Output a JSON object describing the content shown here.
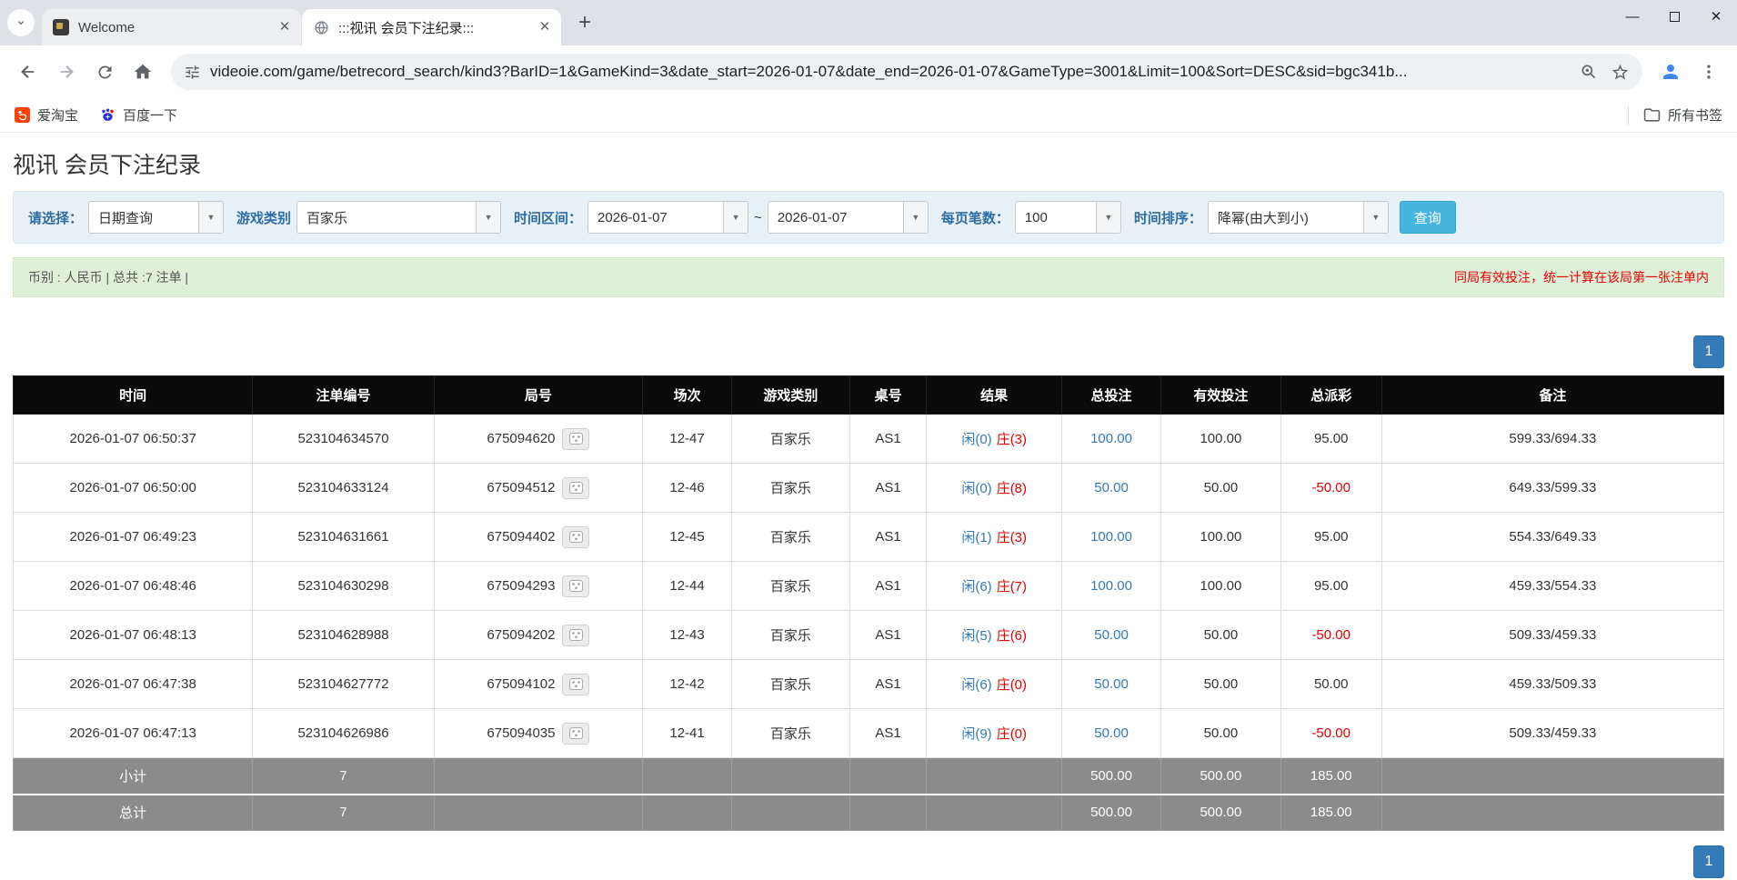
{
  "browser": {
    "tabs": [
      {
        "title": "Welcome"
      },
      {
        "title": ":::视讯 会员下注纪录:::"
      }
    ],
    "url": "videoie.com/game/betrecord_search/kind3?BarID=1&GameKind=3&date_start=2026-01-07&date_end=2026-01-07&GameType=3001&Limit=100&Sort=DESC&sid=bgc341b...",
    "bookmarks": [
      {
        "label": "爱淘宝"
      },
      {
        "label": "百度一下"
      }
    ],
    "all_bookmarks_label": "所有书签"
  },
  "page": {
    "title": "视讯 会员下注纪录",
    "filters": {
      "query_type_label": "请选择：",
      "query_type_value": "日期查询",
      "game_kind_label": "游戏类别",
      "game_kind_value": "百家乐",
      "date_range_label": "时间区间：",
      "date_start": "2026-01-07",
      "date_separator": "~",
      "date_end": "2026-01-07",
      "page_size_label": "每页笔数：",
      "page_size_value": "100",
      "sort_label": "时间排序：",
      "sort_value": "降幂(由大到小)",
      "search_button": "查询"
    },
    "info_bar": {
      "left": "币别 : 人民币 | 总共 :7 注单 |",
      "right": "同局有效投注，统一计算在该局第一张注单内"
    },
    "pagination": "1",
    "table": {
      "headers": [
        "时间",
        "注单编号",
        "局号",
        "场次",
        "游戏类别",
        "桌号",
        "结果",
        "总投注",
        "有效投注",
        "总派彩",
        "备注"
      ],
      "rows": [
        {
          "time": "2026-01-07 06:50:37",
          "bet_id": "523104634570",
          "round_id": "675094620",
          "session": "12-47",
          "game_kind": "百家乐",
          "table_no": "AS1",
          "result_player": "闲(0)",
          "result_banker": "庄(3)",
          "total_bet": "100.00",
          "valid_bet": "100.00",
          "payout": "95.00",
          "note": "599.33/694.33"
        },
        {
          "time": "2026-01-07 06:50:00",
          "bet_id": "523104633124",
          "round_id": "675094512",
          "session": "12-46",
          "game_kind": "百家乐",
          "table_no": "AS1",
          "result_player": "闲(0)",
          "result_banker": "庄(8)",
          "total_bet": "50.00",
          "valid_bet": "50.00",
          "payout": "-50.00",
          "note": "649.33/599.33"
        },
        {
          "time": "2026-01-07 06:49:23",
          "bet_id": "523104631661",
          "round_id": "675094402",
          "session": "12-45",
          "game_kind": "百家乐",
          "table_no": "AS1",
          "result_player": "闲(1)",
          "result_banker": "庄(3)",
          "total_bet": "100.00",
          "valid_bet": "100.00",
          "payout": "95.00",
          "note": "554.33/649.33"
        },
        {
          "time": "2026-01-07 06:48:46",
          "bet_id": "523104630298",
          "round_id": "675094293",
          "session": "12-44",
          "game_kind": "百家乐",
          "table_no": "AS1",
          "result_player": "闲(6)",
          "result_banker": "庄(7)",
          "total_bet": "100.00",
          "valid_bet": "100.00",
          "payout": "95.00",
          "note": "459.33/554.33"
        },
        {
          "time": "2026-01-07 06:48:13",
          "bet_id": "523104628988",
          "round_id": "675094202",
          "session": "12-43",
          "game_kind": "百家乐",
          "table_no": "AS1",
          "result_player": "闲(5)",
          "result_banker": "庄(6)",
          "total_bet": "50.00",
          "valid_bet": "50.00",
          "payout": "-50.00",
          "note": "509.33/459.33"
        },
        {
          "time": "2026-01-07 06:47:38",
          "bet_id": "523104627772",
          "round_id": "675094102",
          "session": "12-42",
          "game_kind": "百家乐",
          "table_no": "AS1",
          "result_player": "闲(6)",
          "result_banker": "庄(0)",
          "total_bet": "50.00",
          "valid_bet": "50.00",
          "payout": "50.00",
          "note": "459.33/509.33"
        },
        {
          "time": "2026-01-07 06:47:13",
          "bet_id": "523104626986",
          "round_id": "675094035",
          "session": "12-41",
          "game_kind": "百家乐",
          "table_no": "AS1",
          "result_player": "闲(9)",
          "result_banker": "庄(0)",
          "total_bet": "50.00",
          "valid_bet": "50.00",
          "payout": "-50.00",
          "note": "509.33/459.33"
        }
      ],
      "subtotal": {
        "label": "小计",
        "count": "7",
        "total_bet": "500.00",
        "valid_bet": "500.00",
        "payout": "185.00"
      },
      "total": {
        "label": "总计",
        "count": "7",
        "total_bet": "500.00",
        "valid_bet": "500.00",
        "payout": "185.00"
      }
    },
    "colors": {
      "accent_blue": "#337ab7",
      "negative_red": "#e60000",
      "header_black": "#0a0a0a",
      "summary_gray": "#8b8b8b",
      "search_button_blue": "#45b6dd",
      "info_green": "#dff0d8",
      "filter_blue_bg": "#e9f1f8"
    }
  }
}
